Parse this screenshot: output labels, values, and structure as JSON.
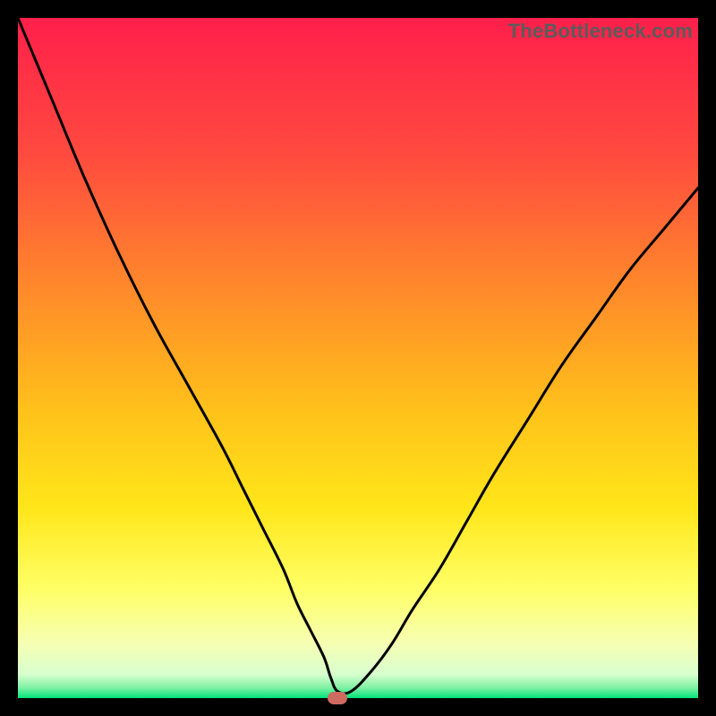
{
  "watermark": "TheBottleneck.com",
  "colors": {
    "gradient_stops": [
      {
        "offset": 0.0,
        "color": "#ff1f4b"
      },
      {
        "offset": 0.2,
        "color": "#ff4a3f"
      },
      {
        "offset": 0.4,
        "color": "#ff8a2a"
      },
      {
        "offset": 0.58,
        "color": "#ffc21a"
      },
      {
        "offset": 0.72,
        "color": "#ffe61a"
      },
      {
        "offset": 0.84,
        "color": "#ffff66"
      },
      {
        "offset": 0.92,
        "color": "#f6ffb3"
      },
      {
        "offset": 0.965,
        "color": "#d8ffce"
      },
      {
        "offset": 0.985,
        "color": "#7df0a3"
      },
      {
        "offset": 1.0,
        "color": "#00e47a"
      }
    ],
    "curve": "#000000",
    "marker": "#cf6a61"
  },
  "chart_data": {
    "type": "line",
    "title": "",
    "xlabel": "",
    "ylabel": "",
    "xlim": [
      0,
      100
    ],
    "ylim": [
      0,
      100
    ],
    "series": [
      {
        "name": "bottleneck-curve",
        "x": [
          0,
          5,
          10,
          15,
          20,
          25,
          30,
          33,
          36,
          39,
          41,
          43,
          45,
          46,
          47,
          49,
          52,
          55,
          58,
          62,
          66,
          70,
          75,
          80,
          85,
          90,
          95,
          100
        ],
        "values": [
          100,
          88,
          76,
          65,
          55,
          46,
          37,
          31,
          25,
          19,
          14,
          10,
          6,
          3,
          1,
          1,
          4,
          8,
          13,
          19,
          26,
          33,
          41,
          49,
          56,
          63,
          69,
          75
        ]
      }
    ],
    "marker": {
      "x": 47,
      "y": 0
    }
  }
}
